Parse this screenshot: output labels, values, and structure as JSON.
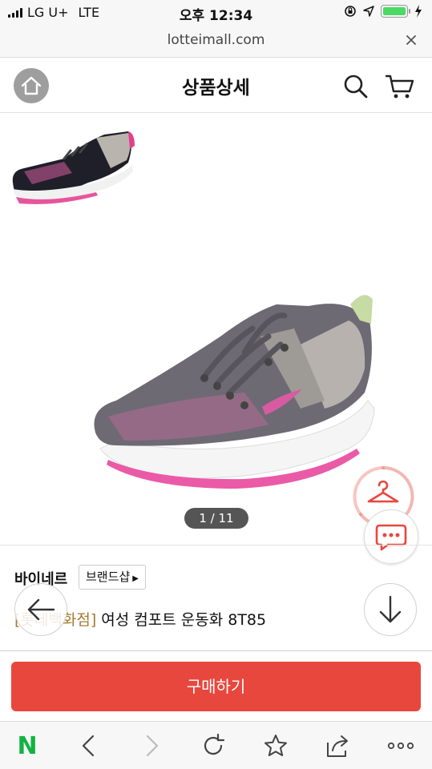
{
  "status_bar": {
    "carrier": "LG U+",
    "network": "LTE",
    "time": "오후 12:34",
    "battery_color": "#4cd964"
  },
  "browser": {
    "url": "lotteimall.com",
    "close_icon": "close-icon"
  },
  "header": {
    "title": "상품상세",
    "home_icon": "home-icon",
    "search_icon": "search-icon",
    "cart_icon": "cart-icon"
  },
  "gallery": {
    "pager": "1 / 11"
  },
  "product": {
    "brand": "바이네르",
    "brand_shop_label": "브랜드샵",
    "store_tag": "[롯데백화점]",
    "name": " 여성 컴포트 운동화 8T85"
  },
  "actions": {
    "buy_label": "구매하기",
    "buy_color": "#e8473d"
  },
  "toolbar": {
    "n_logo": "N",
    "icons": [
      "back-icon",
      "forward-icon",
      "reload-icon",
      "bookmark-star-icon",
      "share-icon",
      "more-icon"
    ]
  }
}
